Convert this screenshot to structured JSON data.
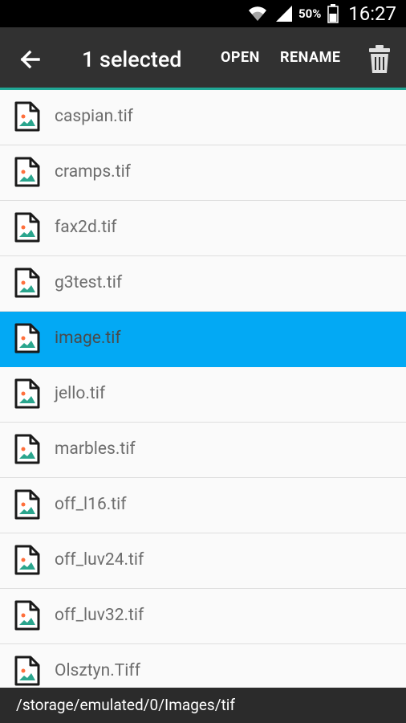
{
  "status_bar": {
    "battery_percent": "50%",
    "time": "16:27"
  },
  "app_bar": {
    "back_icon": "arrow-left-icon",
    "title": "1 selected",
    "actions": {
      "open": "OPEN",
      "rename": "RENAME"
    },
    "delete_icon": "trash-icon"
  },
  "colors": {
    "status_bar_bg": "#000000",
    "app_bar_bg": "#313131",
    "accent": "#20a896",
    "selected_row": "#03a9f4",
    "path_bar_bg": "#2b2b2b"
  },
  "files": [
    {
      "name": "caspian.tif",
      "selected": false
    },
    {
      "name": "cramps.tif",
      "selected": false
    },
    {
      "name": "fax2d.tif",
      "selected": false
    },
    {
      "name": "g3test.tif",
      "selected": false
    },
    {
      "name": "image.tif",
      "selected": true
    },
    {
      "name": "jello.tif",
      "selected": false
    },
    {
      "name": "marbles.tif",
      "selected": false
    },
    {
      "name": "off_l16.tif",
      "selected": false
    },
    {
      "name": "off_luv24.tif",
      "selected": false
    },
    {
      "name": "off_luv32.tif",
      "selected": false
    },
    {
      "name": "Olsztyn.Tiff",
      "selected": false
    }
  ],
  "path_bar": {
    "path": "/storage/emulated/0/Images/tif"
  }
}
